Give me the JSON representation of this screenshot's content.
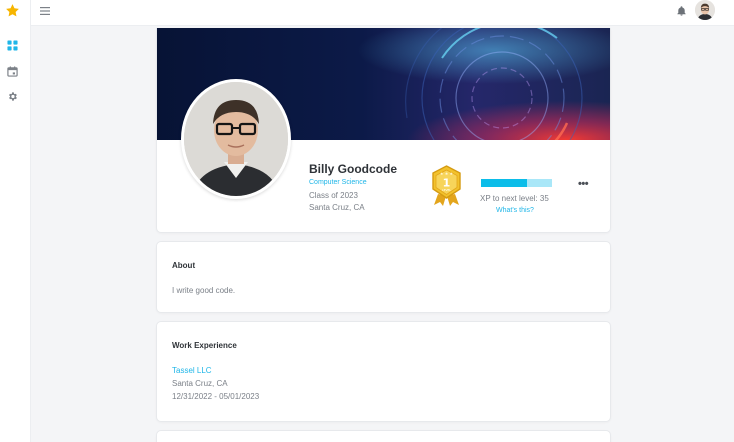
{
  "colors": {
    "accent": "#1fb6e8",
    "xp_fill": "#0bbde9",
    "xp_track": "#a9e7f8",
    "badge_gold": "#f2c22c",
    "logo_star": "#f7b500"
  },
  "icons": {
    "logo": "star-icon",
    "sidebar": [
      "dashboard-icon",
      "calendar-icon",
      "gear-icon"
    ],
    "topbar": [
      "hamburger-icon",
      "bell-icon"
    ]
  },
  "profile": {
    "name": "Billy Goodcode",
    "major": "Computer Science",
    "class_of": "Class of 2023",
    "location": "Santa Cruz, CA",
    "level": {
      "number": "1",
      "label": "LEVEL"
    },
    "xp_progress": 0.65,
    "xp_text": "XP to next level: 35",
    "whats_this": "What's this?",
    "more": "•••"
  },
  "about": {
    "title": "About",
    "text": "I write good code."
  },
  "work": {
    "title": "Work Experience",
    "company": "Tassel LLC",
    "location": "Santa Cruz, CA",
    "dates": "12/31/2022 - 05/01/2023"
  }
}
